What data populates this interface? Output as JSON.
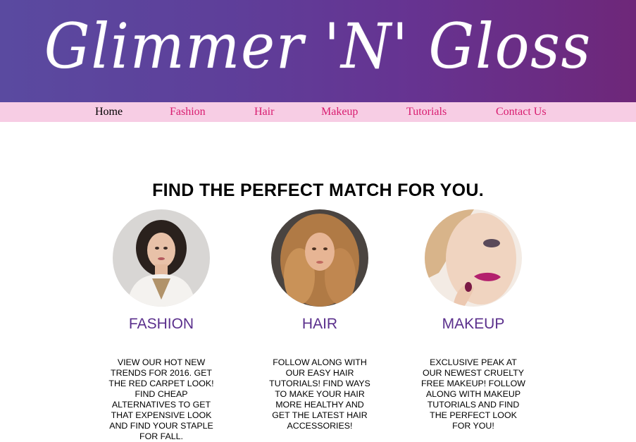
{
  "site": {
    "title": "Glimmer 'N' Gloss"
  },
  "nav": {
    "items": [
      {
        "label": "Home",
        "active": true
      },
      {
        "label": "Fashion",
        "active": false
      },
      {
        "label": "Hair",
        "active": false
      },
      {
        "label": "Makeup",
        "active": false
      },
      {
        "label": "Tutorials",
        "active": false
      },
      {
        "label": "Contact Us",
        "active": false
      }
    ]
  },
  "main": {
    "headline": "FIND THE PERFECT MATCH FOR YOU.",
    "cards": [
      {
        "title": "FASHION",
        "text": "VIEW OUR HOT NEW TRENDS FOR 2016. GET THE RED CARPET LOOK! FIND CHEAP ALTERNATIVES TO GET THAT EXPENSIVE LOOK AND FIND YOUR STAPLE FOR FALL."
      },
      {
        "title": "HAIR",
        "text": "FOLLOW ALONG WITH OUR EASY HAIR TUTORIALS! FIND WAYS TO MAKE YOUR HAIR MORE HEALTHY AND GET THE LATEST HAIR ACCESSORIES!"
      },
      {
        "title": "MAKEUP",
        "text": "EXCLUSIVE PEAK AT OUR NEWEST CRUELTY FREE MAKEUP! FOLLOW ALONG WITH MAKEUP TUTORIALS AND FIND THE PERFECT LOOK FOR YOU!"
      }
    ]
  },
  "colors": {
    "banner_start": "#5a4aa0",
    "banner_end": "#6e2779",
    "nav_background": "#f7cde4",
    "nav_link": "#d81b6f",
    "card_title": "#5a2f8c"
  }
}
